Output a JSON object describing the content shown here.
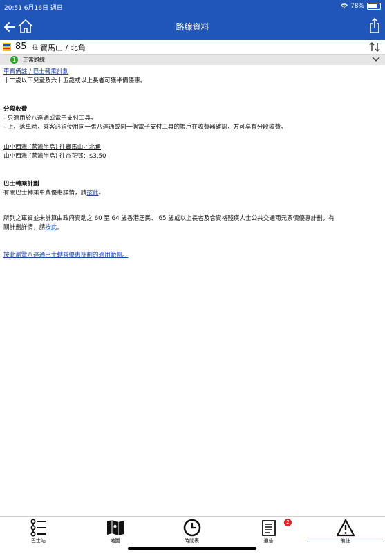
{
  "status_bar": {
    "time_date": "20:51  6月16日 週日",
    "battery": "78%"
  },
  "nav": {
    "title": "路線資料"
  },
  "route": {
    "number": "85",
    "to_label": "往",
    "destination": "寶馬山 / 北角"
  },
  "route_status": {
    "index": "1",
    "text": "正常路線"
  },
  "content": {
    "section1_title": "車費備註 / 巴士轉乘計劃",
    "section1_text": "十二歲以下兒童及六十五歲或以上長者可獲半價優惠。",
    "section2_title": "分段收費",
    "section2_line1": "- 只適用於八達通或電子支付工具。",
    "section2_line2": "- 上、落車時，乘客必須使用同一張八達通或同一個電子支付工具的帳戶在收費器確認，方可享有分段收費。",
    "section3_heading": "由小西灣 (藍灣半島) 往寶馬山／北角",
    "section3_fare": "由小西灣 (藍灣半島) 往杏花邨：$3.50",
    "section4_title": "巴士轉乘計劃",
    "section4_text_pre": "有關巴士轉乘車費優惠詳情，請",
    "section4_link": "按此",
    "section4_text_post": "。",
    "section5_line1": "所列之車資並未計算由政府資助之 60 至 64 歲香港居民、 65 歲或以上長者及合資格殘疾人士公共交通兩元票價優惠計劃，有",
    "section5_line2_pre": "關計劃詳情，請",
    "section5_link": "按此",
    "section5_line2_post": "。",
    "section6_link": "按此瀏覽八達通巴士轉乘優惠計劃的適用範圍。"
  },
  "tabs": [
    {
      "label": "巴士站",
      "icon": "bus-stop-list-icon"
    },
    {
      "label": "地圖",
      "icon": "map-icon"
    },
    {
      "label": "時間表",
      "icon": "clock-icon"
    },
    {
      "label": "通告",
      "icon": "notice-icon",
      "badge": "2"
    },
    {
      "label": "備註",
      "icon": "warning-icon",
      "active": true
    }
  ]
}
